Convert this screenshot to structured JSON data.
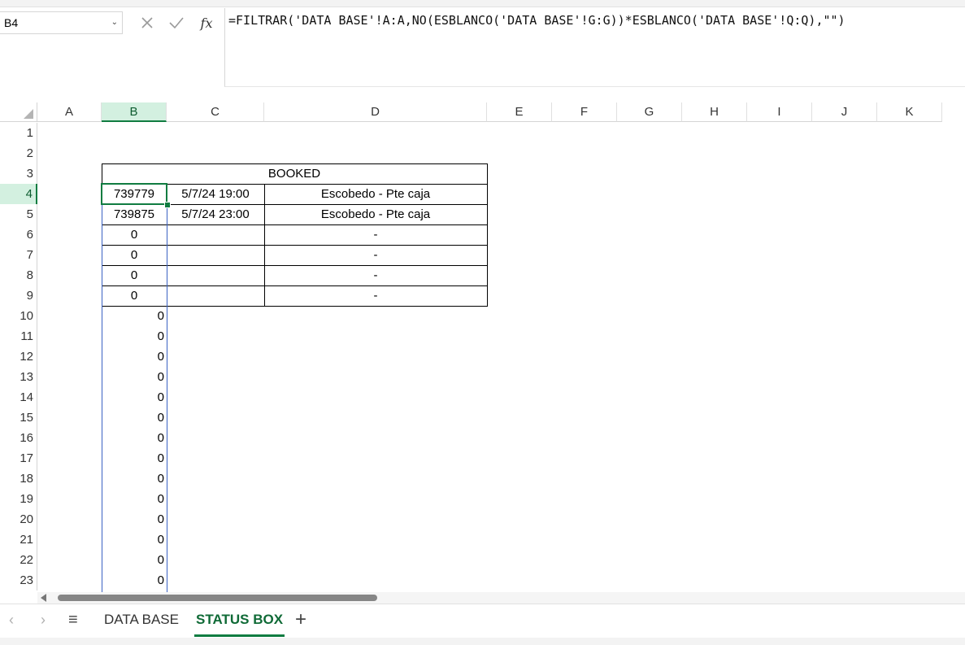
{
  "name_box": {
    "value": "B4"
  },
  "formula_bar": {
    "fx_label": "fx",
    "formula": "=FILTRAR('DATA BASE'!A:A,NO(ESBLANCO('DATA BASE'!G:G))*ESBLANCO('DATA BASE'!Q:Q),\"\")"
  },
  "columns": [
    "A",
    "B",
    "C",
    "D",
    "E",
    "F",
    "G",
    "H",
    "I",
    "J",
    "K"
  ],
  "rows": [
    "1",
    "2",
    "3",
    "4",
    "5",
    "6",
    "7",
    "8",
    "9",
    "10",
    "11",
    "12",
    "13",
    "14",
    "15",
    "16",
    "17",
    "18",
    "19",
    "20",
    "21",
    "22",
    "23"
  ],
  "table": {
    "header": "BOOKED",
    "rows": [
      {
        "id": "739779",
        "date": "5/7/24 19:00",
        "status": "Escobedo - Pte caja"
      },
      {
        "id": "739875",
        "date": "5/7/24 23:00",
        "status": "Escobedo - Pte caja"
      },
      {
        "id": "0",
        "date": "",
        "status": "-"
      },
      {
        "id": "0",
        "date": "",
        "status": "-"
      },
      {
        "id": "0",
        "date": "",
        "status": "-"
      },
      {
        "id": "0",
        "date": "",
        "status": "-"
      }
    ]
  },
  "spill_values": [
    "0",
    "0",
    "0",
    "0",
    "0",
    "0",
    "0",
    "0",
    "0",
    "0",
    "0",
    "0",
    "0",
    "0"
  ],
  "sheet_tabs": [
    {
      "label": "DATA BASE",
      "active": false
    },
    {
      "label": "STATUS BOX",
      "active": true
    }
  ],
  "active_cell": "B4",
  "colors": {
    "accent_green": "#107c41",
    "spill_blue": "#3b62c4"
  }
}
